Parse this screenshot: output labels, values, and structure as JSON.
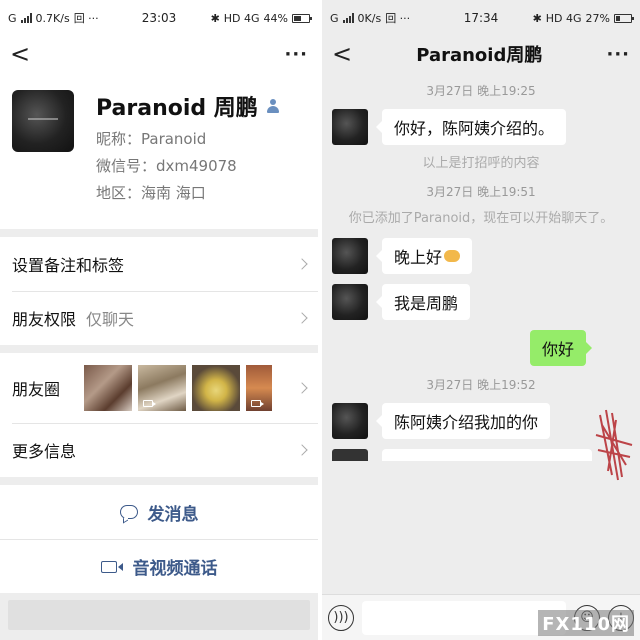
{
  "left": {
    "status_bar": {
      "signal": "G",
      "speed": "0.7K/s",
      "extra": "回 ···",
      "time": "23:03",
      "network": "HD 4G",
      "battery": "44%"
    },
    "nav": {
      "back": "<",
      "more": "···"
    },
    "profile": {
      "name": "Paranoid 周鹏",
      "nickname": "昵称：Paranoid",
      "wechat_id": "微信号：dxm49078",
      "region": "地区：海南  海口"
    },
    "menu": {
      "remark_tags": "设置备注和标签",
      "permission_label": "朋友权限",
      "permission_value": "仅聊天",
      "moments": "朋友圈",
      "more_info": "更多信息"
    },
    "actions": {
      "send_message": "发消息",
      "video_call": "音视频通话"
    }
  },
  "right": {
    "status_bar": {
      "signal": "G",
      "speed": "0K/s",
      "extra": "回 ···",
      "time": "17:34",
      "network": "HD 4G",
      "battery": "27%"
    },
    "nav": {
      "back": "<",
      "title": "Paranoid周鹏",
      "more": "···"
    },
    "messages": {
      "ts1": "3月27日  晚上19:25",
      "m1": "你好，陈阿姨介绍的。",
      "sys1": "以上是打招呼的内容",
      "ts2": "3月27日  晚上19:51",
      "sys2": "你已添加了Paranoid，现在可以开始聊天了。",
      "m2": "晚上好",
      "m3": "我是周鹏",
      "m4": "你好",
      "ts3": "3月27日  晚上19:52",
      "m5": "陈阿姨介绍我加的你"
    },
    "watermark": "FX110网"
  }
}
